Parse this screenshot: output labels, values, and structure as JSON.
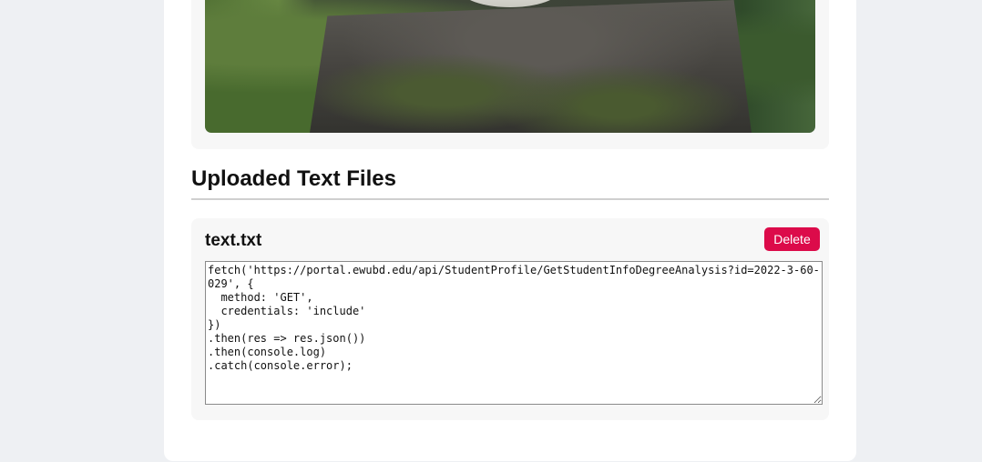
{
  "image_section": {
    "image_description": "moss-covered stone with bowl among leaves"
  },
  "text_files_section": {
    "title": "Uploaded Text Files",
    "files": [
      {
        "name": "text.txt",
        "delete_label": "Delete",
        "content": "fetch('https://portal.ewubd.edu/api/StudentProfile/GetStudentInfoDegreeAnalysis?id=2022-3-60-029', {\n  method: 'GET',\n  credentials: 'include'\n})\n.then(res => res.json())\n.then(console.log)\n.catch(console.error);"
      }
    ]
  },
  "colors": {
    "page_background": "#eef0f3",
    "card_background": "#ffffff",
    "panel_background": "#f7f7f7",
    "delete_button": "#dc0b4a"
  }
}
